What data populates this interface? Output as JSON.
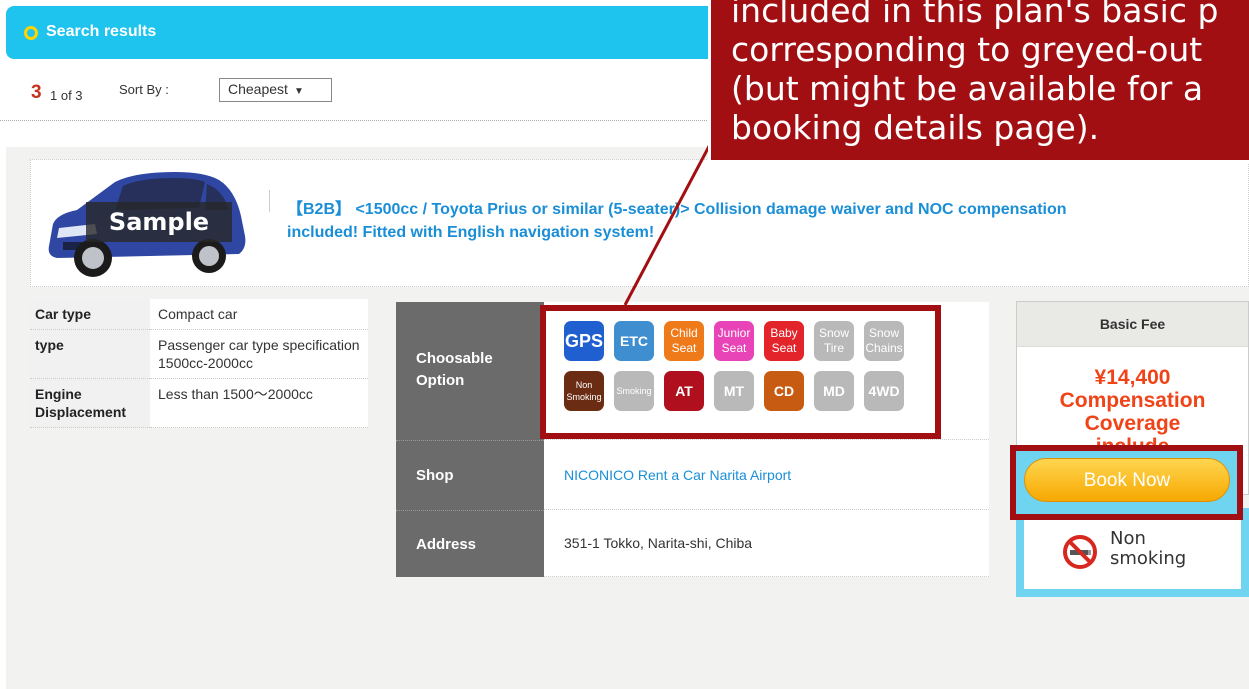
{
  "header": {
    "title": "Search results"
  },
  "results": {
    "current": "3",
    "count_text": "1 of 3",
    "sort_label": "Sort By :",
    "sort_value": "Cheapest"
  },
  "listing": {
    "sample_label": "Sample",
    "title": "【B2B】 <1500cc / Toyota Prius or similar (5-seater)> Collision damage waiver and NOC compensation included! Fitted with English navigation system!",
    "specs": [
      {
        "label": "Car type",
        "value": "Compact car"
      },
      {
        "label": "type",
        "value": "Passenger car type specification 1500cc-2000cc"
      },
      {
        "label": "Engine Displacement",
        "value": "Less than 1500～2000cc"
      }
    ],
    "choosable_option_label": "Choosable Option",
    "options": [
      {
        "label": "GPS",
        "color": "#1f5fcf",
        "available": true
      },
      {
        "label": "ETC",
        "color": "#3e8ed0",
        "available": true
      },
      {
        "label": "Child Seat",
        "color": "#ef7a1a",
        "available": true
      },
      {
        "label": "Junior Seat",
        "color": "#e843b7",
        "available": true
      },
      {
        "label": "Baby Seat",
        "color": "#e3242b",
        "available": true
      },
      {
        "label": "Snow Tire",
        "color": "#b9b9b9",
        "available": false
      },
      {
        "label": "Snow Chains",
        "color": "#b9b9b9",
        "available": false
      },
      {
        "label": "Non Smoking",
        "color": "#6b2c14",
        "available": true
      },
      {
        "label": "Smoking",
        "color": "#b9b9b9",
        "available": false
      },
      {
        "label": "AT",
        "color": "#b0101e",
        "available": true
      },
      {
        "label": "MT",
        "color": "#b9b9b9",
        "available": false
      },
      {
        "label": "CD",
        "color": "#c75b12",
        "available": true
      },
      {
        "label": "MD",
        "color": "#b9b9b9",
        "available": false
      },
      {
        "label": "4WD",
        "color": "#b9b9b9",
        "available": false
      }
    ],
    "shop_label": "Shop",
    "shop_value": "NICONICO Rent a Car Narita Airport",
    "address_label": "Address",
    "address_value": "351-1 Tokko, Narita-shi, Chiba",
    "basic_fee_label": "Basic Fee",
    "price": "¥14,400",
    "coverage_lines": [
      "Compensation",
      "Coverage",
      "include"
    ],
    "non_smoking_lines": [
      "Non",
      "smoking"
    ],
    "book_now": "Book Now"
  },
  "callout": {
    "lines": [
      "included in this plan's basic p",
      "corresponding to greyed-out",
      "(but might be available for a",
      "booking details page)."
    ]
  }
}
